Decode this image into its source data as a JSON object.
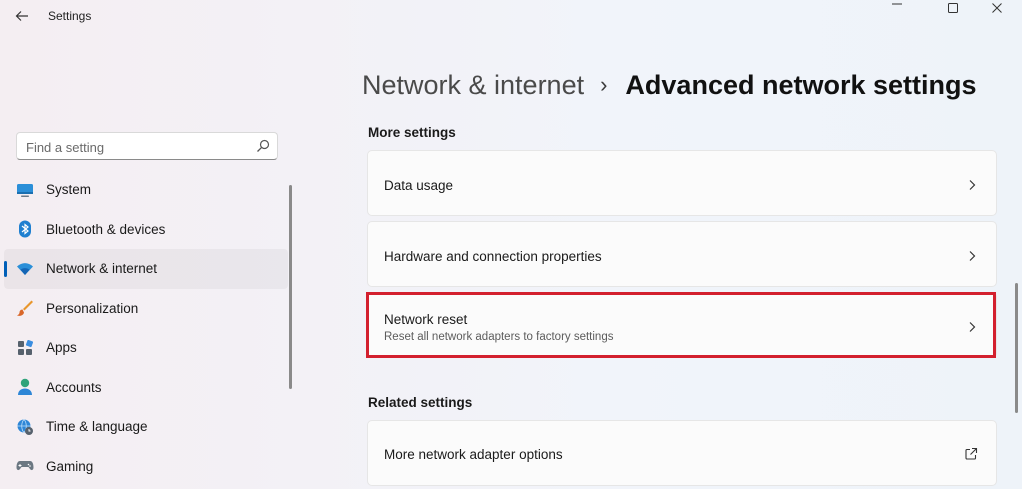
{
  "app": {
    "title": "Settings"
  },
  "breadcrumb": {
    "parent": "Network & internet",
    "separator": "›",
    "current": "Advanced network settings"
  },
  "search": {
    "placeholder": "Find a setting"
  },
  "sidebar": {
    "items": [
      {
        "label": "System",
        "icon": "system-icon",
        "selected": false
      },
      {
        "label": "Bluetooth & devices",
        "icon": "bluetooth-icon",
        "selected": false
      },
      {
        "label": "Network & internet",
        "icon": "wifi-icon",
        "selected": true
      },
      {
        "label": "Personalization",
        "icon": "paintbrush-icon",
        "selected": false
      },
      {
        "label": "Apps",
        "icon": "apps-icon",
        "selected": false
      },
      {
        "label": "Accounts",
        "icon": "accounts-icon",
        "selected": false
      },
      {
        "label": "Time & language",
        "icon": "globe-clock-icon",
        "selected": false
      },
      {
        "label": "Gaming",
        "icon": "gaming-icon",
        "selected": false
      }
    ]
  },
  "main": {
    "more_settings": {
      "title": "More settings",
      "items": [
        {
          "title": "Data usage",
          "subtitle": ""
        },
        {
          "title": "Hardware and connection properties",
          "subtitle": ""
        },
        {
          "title": "Network reset",
          "subtitle": "Reset all network adapters to factory settings"
        }
      ]
    },
    "related_settings": {
      "title": "Related settings",
      "items": [
        {
          "title": "More network adapter options",
          "subtitle": ""
        }
      ]
    }
  },
  "colors": {
    "accent": "#005fb8",
    "highlight": "#d3202e"
  }
}
